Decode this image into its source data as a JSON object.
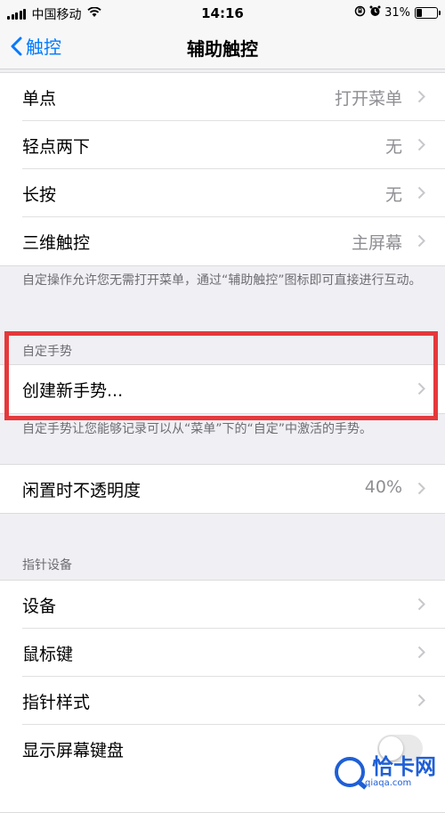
{
  "status_bar": {
    "carrier": "中国移动",
    "time": "14:16",
    "battery_percent": "31%",
    "battery_level": 0.31
  },
  "nav": {
    "back_label": "触控",
    "title": "辅助触控"
  },
  "actions": {
    "rows": [
      {
        "label": "单点",
        "value": "打开菜单"
      },
      {
        "label": "轻点两下",
        "value": "无"
      },
      {
        "label": "长按",
        "value": "无"
      },
      {
        "label": "三维触控",
        "value": "主屏幕"
      }
    ],
    "footer": "自定操作允许您无需打开菜单，通过“辅助触控”图标即可直接进行互动。"
  },
  "custom_gestures": {
    "header": "自定手势",
    "create_label": "创建新手势...",
    "footer": "自定手势让您能够记录可以从“菜单”下的“自定”中激活的手势。"
  },
  "idle_opacity": {
    "label": "闲置时不透明度",
    "value": "40%"
  },
  "pointer_devices": {
    "header": "指针设备",
    "rows": [
      {
        "label": "设备"
      },
      {
        "label": "鼠标键"
      },
      {
        "label": "指针样式"
      }
    ],
    "show_keyboard_label": "显示屏幕键盘",
    "show_keyboard_on": false
  },
  "watermark": {
    "title": "恰卡网",
    "subtitle": "qiaqa.com"
  },
  "colors": {
    "accent": "#007aff",
    "highlight": "#e5383b",
    "watermark": "#1f5fd6"
  }
}
